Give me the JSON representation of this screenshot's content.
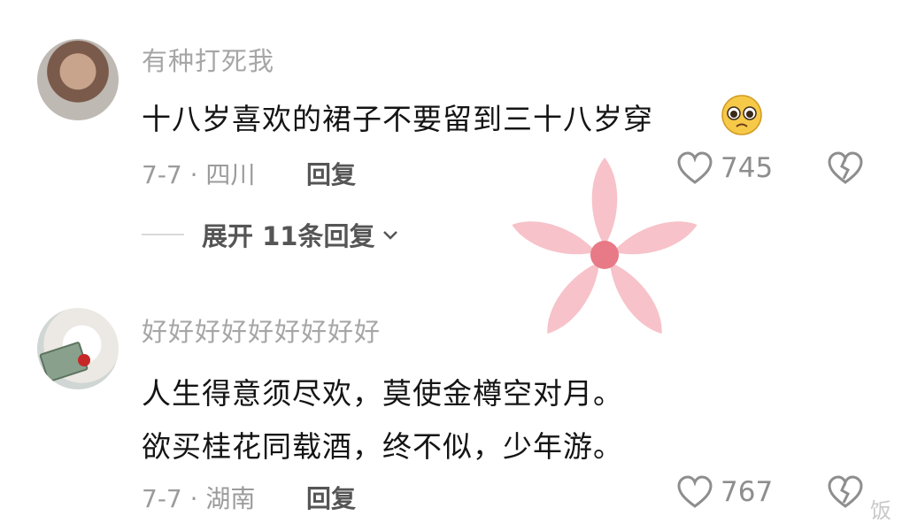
{
  "comments": [
    {
      "username": "有种打死我",
      "lines": [
        "十八岁喜欢的裙子不要留到三十八岁穿"
      ],
      "meta": "7-7 · 四川",
      "reply_label": "回复",
      "likes": "745",
      "expand_label": "展开 11条回复"
    },
    {
      "username": "好好好好好好好好好",
      "lines": [
        "人生得意须尽欢，莫使金樽空对月。",
        "欲买桂花同载酒，终不似，少年游。"
      ],
      "meta": "7-7 · 湖南",
      "reply_label": "回复",
      "likes": "767"
    }
  ],
  "icons": {
    "like": "heart-outline-icon",
    "dislike": "broken-heart-icon",
    "expand": "chevron-down-icon",
    "emoji": "pleading-face-emoji"
  },
  "colors": {
    "flower_petal": "#f6b7bf",
    "flower_center": "#e77a86",
    "text_primary": "#141414",
    "text_secondary": "#9b9b9b"
  },
  "watermark": "饭"
}
